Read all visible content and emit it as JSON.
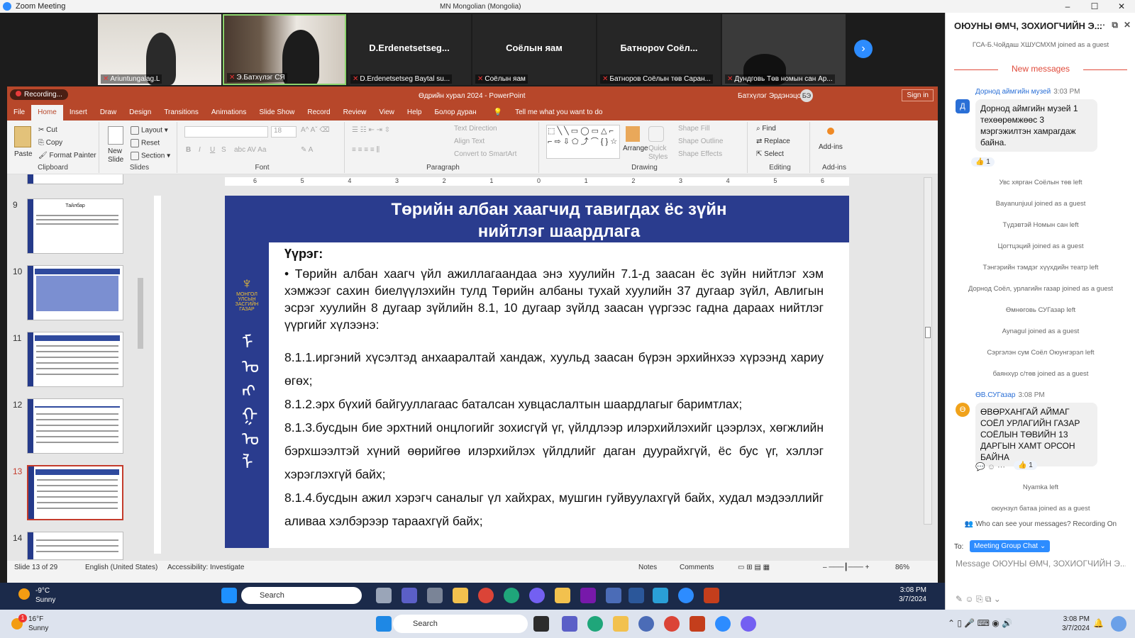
{
  "window": {
    "title": "Zoom Meeting",
    "center": "MN Mongolian (Mongolia)",
    "controls": [
      "–",
      "☐",
      "✕"
    ]
  },
  "gallery": {
    "tiles": [
      {
        "name": "",
        "label": "Ariuntungalag.L",
        "video": true
      },
      {
        "name": "",
        "label": "Э.Батхүлэг СЯ",
        "video": true
      },
      {
        "name": "D.Erdenetsetseg...",
        "label": "D.Erdenetsetseg  Baytal su...",
        "video": false
      },
      {
        "name": "Соёлын яам",
        "label": "Соёлын яам",
        "video": false
      },
      {
        "name": "Батнорov Соёл...",
        "label": "Батноров Соёлын төв Саран...",
        "video": false
      },
      {
        "name": "",
        "label": "Дундговь Төв номын сан Ар...",
        "video": true
      }
    ],
    "next_label": "›"
  },
  "ppt": {
    "recording": "Recording...",
    "doc_title": "Өдрийн хурал 2024 - PowerPoint",
    "user": "Батхүлэг Эрдэнэцогт",
    "user_initials": "БЭ",
    "signin": "Sign in",
    "tabs": [
      "File",
      "Home",
      "Insert",
      "Draw",
      "Design",
      "Transitions",
      "Animations",
      "Slide Show",
      "Record",
      "Review",
      "View",
      "Help",
      "Болор дуран"
    ],
    "tellme": "Tell me what you want to do",
    "ribbon": {
      "clipboard": {
        "paste": "Paste",
        "cut": "Cut",
        "copy": "Copy",
        "format_painter": "Format Painter",
        "label": "Clipboard"
      },
      "slides": {
        "new_slide": "New Slide",
        "layout": "Layout",
        "reset": "Reset",
        "section": "Section",
        "label": "Slides"
      },
      "font": {
        "label": "Font",
        "size": "18"
      },
      "paragraph": {
        "label": "Paragraph",
        "text_direction": "Text Direction",
        "align_text": "Align Text",
        "convert": "Convert to SmartArt"
      },
      "drawing": {
        "label": "Drawing",
        "arrange": "Arrange",
        "quick_styles": "Quick Styles",
        "shape_fill": "Shape Fill",
        "shape_outline": "Shape Outline",
        "shape_effects": "Shape Effects"
      },
      "editing": {
        "label": "Editing",
        "find": "Find",
        "replace": "Replace",
        "select": "Select"
      },
      "addins": {
        "label": "Add-ins",
        "addins": "Add-ins"
      }
    },
    "thumbs": [
      {
        "num": "9",
        "title": "Тайлбар"
      },
      {
        "num": "10",
        "title": ""
      },
      {
        "num": "11",
        "title": ""
      },
      {
        "num": "12",
        "title": ""
      },
      {
        "num": "13",
        "title": ""
      },
      {
        "num": "14",
        "title": ""
      }
    ],
    "ruler_numbers": [
      "6",
      "5",
      "4",
      "3",
      "2",
      "1",
      "0",
      "1",
      "2",
      "3",
      "4",
      "5",
      "6"
    ],
    "slide": {
      "title_line1": "Төрийн албан хаагчид тавигдах ёс зүйн",
      "title_line2": "нийтлэг шаардлага",
      "emblem_text": "МОНГОЛ УЛСЫН ЗАСГИЙН ГАЗАР",
      "heading": "Үүрэг:",
      "bullet": "•     Төрийн албан хаагч үйл ажиллагаандаа энэ хуулийн 7.1-д заасан ёс зүйн нийтлэг хэм хэмжээг сахин биелүүлэхийн тулд Төрийн албаны тухай хуулийн 37 дугаар зүйл, Авлигын эсрэг хуулийн 8 дугаар зүйлийн 8.1, 10 дугаар зүйлд заасан үүргээс гадна дараах нийтлэг үүргийг хүлээнэ:",
      "p1": "8.1.1.иргэний хүсэлтэд анхааралтай хандаж, хуульд заасан бүрэн эрхийнхээ хүрээнд хариу өгөх;",
      "p2": "8.1.2.эрх бүхий байгууллагаас баталсан хувцаслалтын шаардлагыг баримтлах;",
      "p3": "8.1.3.бусдын бие эрхтний онцлогийг зохисгүй үг, үйлдлээр илэрхийлэхийг цээрлэх, хөгжлийн бэрхшээлтэй хүний өөрийгөө илэрхийлэх үйлдлийг даган дуурайхгүй, ёс бус үг, хэллэг хэрэглэхгүй байх;",
      "p4": "8.1.4.бусдын ажил хэрэгч саналыг үл хайхрах, мушгин гуйвуулахгүй байх, худал мэдээллийг аливаа хэлбэрээр тараахгүй байх;"
    },
    "status": {
      "slide": "Slide 13 of 29",
      "language": "English (United States)",
      "accessibility": "Accessibility: Investigate",
      "notes": "Notes",
      "comments": "Comments",
      "zoom": "86%"
    }
  },
  "chat": {
    "title": "ОЮУНЫ ӨМЧ, ЗОХИОГЧИЙН Э...",
    "sys_top": "ГСА-Б.Чойдаш ХШУСМХМ joined as a guest",
    "new_messages": "New messages",
    "msg1": {
      "sender": "Дорнод аймгийн музей",
      "time": "3:03 PM",
      "avatar": "Д",
      "text": "Дорнод аймгийн музей 1 техөөрөмжөөс 3 мэргэжилтэн хамрагдаж байна.",
      "reaction": "👍 1"
    },
    "sys_list": [
      "Увс хярган Соёлын төв left",
      "Bayanunjuul joined as a guest",
      "Түдэвтэй Номын сан left",
      "Цогтцэций joined as a guest",
      "Тэнгэрийн тэмдэг хүүхдийн театр left",
      "Дорнод Соёл, урлагийн газар joined as a guest",
      "Өмнөговь СУГазар left",
      "Aynagul joined as a guest",
      "Сэргэлэн сум Соёл Оюунгэрэл left",
      "баянхүр с/төв joined as a guest"
    ],
    "msg2": {
      "sender": "ӨВ.СУГазар",
      "time": "3:08 PM",
      "avatar": "Ө",
      "text": "ӨВӨРХАНГАЙ АЙМАГ СОЁЛ УРЛАГИЙН ГАЗАР СОЁЛЫН ТӨВИЙН 13 ДАРГЫН ХАМТ ОРСОН БАЙНА",
      "reaction": "👍 1"
    },
    "sys_bottom": [
      "Nyamka left",
      "оюунзул батаа joined as a guest"
    ],
    "who_can_see": "Who can see your messages? Recording On",
    "to_label": "To:",
    "to_value": "Meeting Group Chat ⌄",
    "placeholder": "Message ОЮУНЫ ӨМЧ, ЗОХИОГЧИЙН Э..."
  },
  "remote_taskbar": {
    "temp": "-9°C",
    "cond": "Sunny",
    "search": "Search",
    "time": "3:08 PM",
    "date": "3/7/2024"
  },
  "local_taskbar": {
    "temp": "16°F",
    "cond": "Sunny",
    "search": "Search",
    "time": "3:08 PM",
    "date": "3/7/2024",
    "weather_badge": "1"
  },
  "colors": {
    "ppt_red": "#b7472a",
    "slide_blue": "#2a3c8e",
    "zoom_blue": "#2d8cff",
    "alert_red": "#e04a3a"
  }
}
